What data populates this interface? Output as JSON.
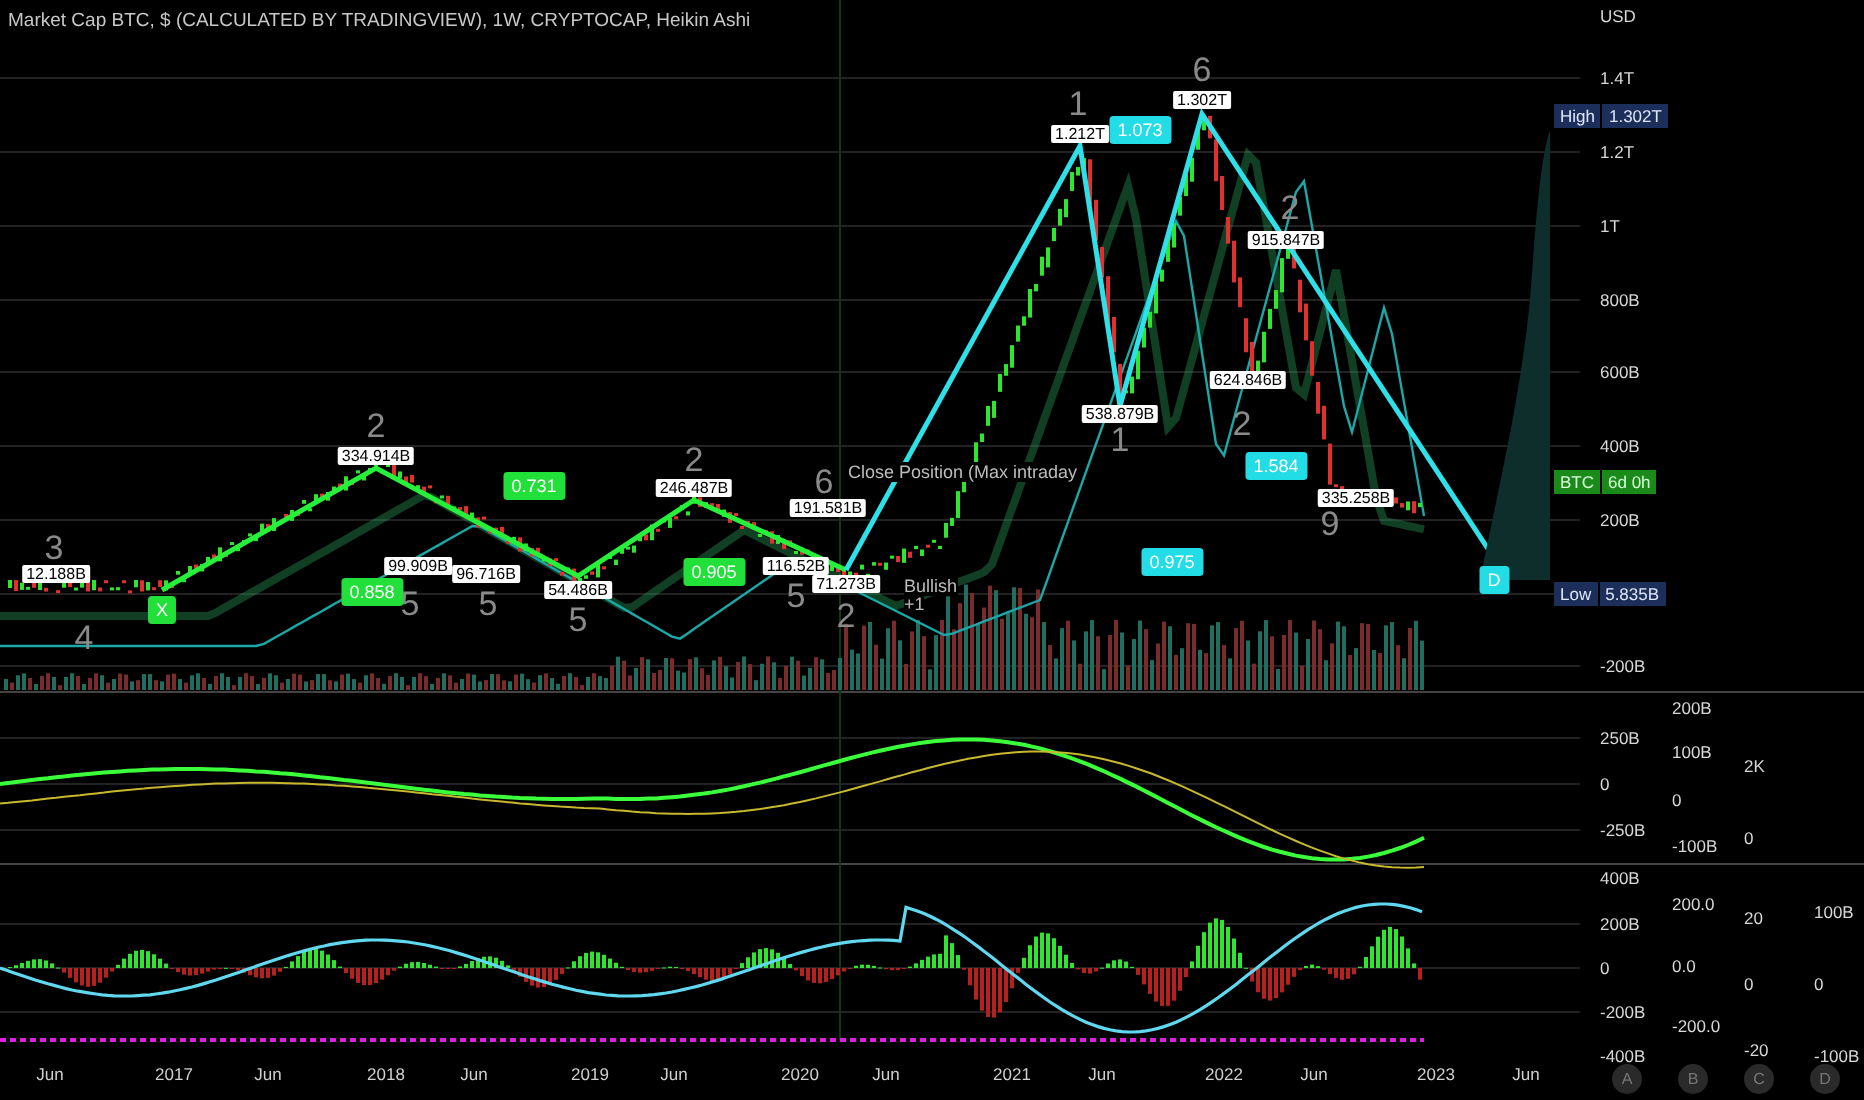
{
  "title": "Market Cap BTC, $ (CALCULATED BY TRADINGVIEW), 1W, CRYPTOCAP, Heikin Ashi",
  "price_axis": {
    "unit": "USD",
    "ticks": [
      "1.4T",
      "1.2T",
      "1T",
      "800B",
      "600B",
      "400B",
      "200B",
      "-200B"
    ]
  },
  "high_marker": {
    "label": "High",
    "value": "1.302T"
  },
  "countdown_marker": {
    "label": "BTC",
    "value": "6d 0h"
  },
  "low_marker": {
    "label": "Low",
    "value": "5.835B"
  },
  "price_tags": [
    "12.188B",
    "334.914B",
    "99.909B",
    "96.716B",
    "54.486B",
    "246.487B",
    "191.581B",
    "116.52B",
    "71.273B",
    "1.212T",
    "1.302T",
    "915.847B",
    "624.846B",
    "538.879B",
    "335.258B"
  ],
  "ratio_badges": [
    {
      "text": "0.731",
      "color": "#22e03a"
    },
    {
      "text": "0.858",
      "color": "#22e03a"
    },
    {
      "text": "0.905",
      "color": "#22e03a"
    },
    {
      "text": "1.073",
      "color": "#22dde6"
    },
    {
      "text": "1.584",
      "color": "#22dde6"
    },
    {
      "text": "0.975",
      "color": "#22dde6"
    }
  ],
  "point_labels": [
    {
      "text": "X",
      "color": "#22e03a"
    },
    {
      "text": "D",
      "color": "#22dde6"
    }
  ],
  "wave_numbers": [
    "3",
    "4",
    "2",
    "5",
    "5",
    "5",
    "2",
    "5",
    "6",
    "2",
    "1",
    "6",
    "2",
    "1",
    "2",
    "9"
  ],
  "notes": [
    "Close Position (Max intraday",
    "Bullish",
    "+1"
  ],
  "oscillator_1": {
    "scales": [
      [
        "250B",
        "0",
        "-250B"
      ],
      [
        "200B",
        "100B",
        "0",
        "-100B"
      ],
      [
        "2K",
        "0"
      ]
    ]
  },
  "oscillator_2": {
    "scales": [
      [
        "400B",
        "200B",
        "0",
        "-200B",
        "-400B"
      ],
      [
        "200.0",
        "0.0",
        "-200.0"
      ],
      [
        "20",
        "0",
        "-20"
      ],
      [
        "100B",
        "0",
        "-100B"
      ]
    ]
  },
  "time_axis": [
    "Jun",
    "2017",
    "Jun",
    "2018",
    "Jun",
    "2019",
    "Jun",
    "2020",
    "Jun",
    "2021",
    "Jun",
    "2022",
    "Jun",
    "2023",
    "Jun"
  ],
  "scale_buttons": [
    "A",
    "B",
    "C",
    "D"
  ]
}
